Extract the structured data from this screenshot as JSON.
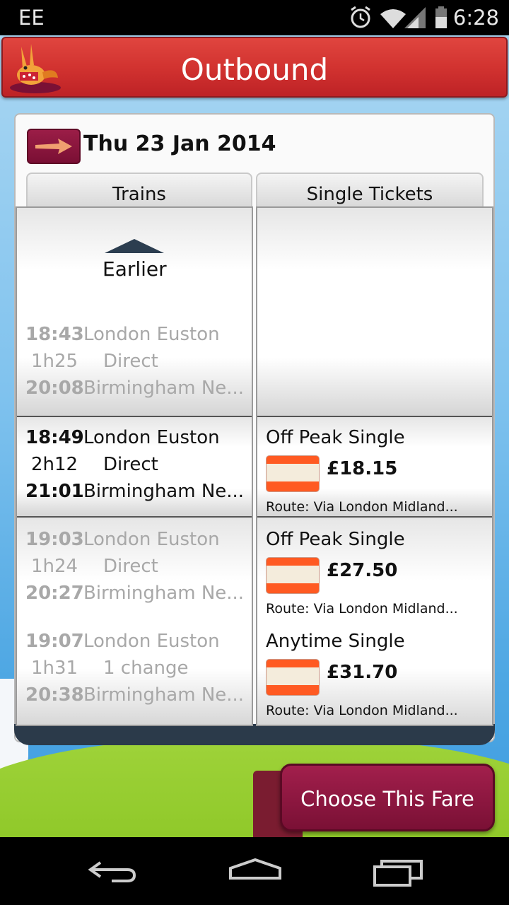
{
  "status_bar": {
    "carrier": "EE",
    "time": "6:28",
    "icons": [
      "alarm-icon",
      "wifi-icon",
      "signal-icon",
      "battery-icon"
    ]
  },
  "header": {
    "title": "Outbound"
  },
  "date_row": {
    "date": "Thu 23 Jan 2014"
  },
  "columns": {
    "trains_label": "Trains",
    "tickets_label": "Single Tickets"
  },
  "earlier": {
    "label": "Earlier"
  },
  "trains": [
    {
      "depart_time": "18:43",
      "depart_station": "London Euston",
      "duration": "1h25",
      "changes": "Direct",
      "arrive_time": "20:08",
      "arrive_station": "Birmingham Ne...",
      "selected": false
    },
    {
      "depart_time": "18:49",
      "depart_station": "London Euston",
      "duration": "2h12",
      "changes": "Direct",
      "arrive_time": "21:01",
      "arrive_station": "Birmingham Ne...",
      "selected": true
    },
    {
      "depart_time": "19:03",
      "depart_station": "London Euston",
      "duration": "1h24",
      "changes": "Direct",
      "arrive_time": "20:27",
      "arrive_station": "Birmingham Ne...",
      "selected": false
    },
    {
      "depart_time": "19:07",
      "depart_station": "London Euston",
      "duration": "1h31",
      "changes": "1 change",
      "arrive_time": "20:38",
      "arrive_station": "Birmingham Ne...",
      "selected": false
    }
  ],
  "fares": [
    {
      "name": "Off Peak Single",
      "price": "£18.15",
      "route": "Route: Via London Midland..."
    },
    {
      "name": "Off Peak Single",
      "price": "£27.50",
      "route": "Route: Via London Midland..."
    },
    {
      "name": "Anytime Single",
      "price": "£31.70",
      "route": "Route: Via London Midland..."
    }
  ],
  "action": {
    "choose_label": "Choose This Fare"
  },
  "nav": {
    "icons": [
      "back-icon",
      "home-icon",
      "recent-apps-icon"
    ]
  },
  "colors": {
    "header_red": "#d23330",
    "maroon": "#7a1035",
    "ticket_orange": "#ff5a22"
  }
}
